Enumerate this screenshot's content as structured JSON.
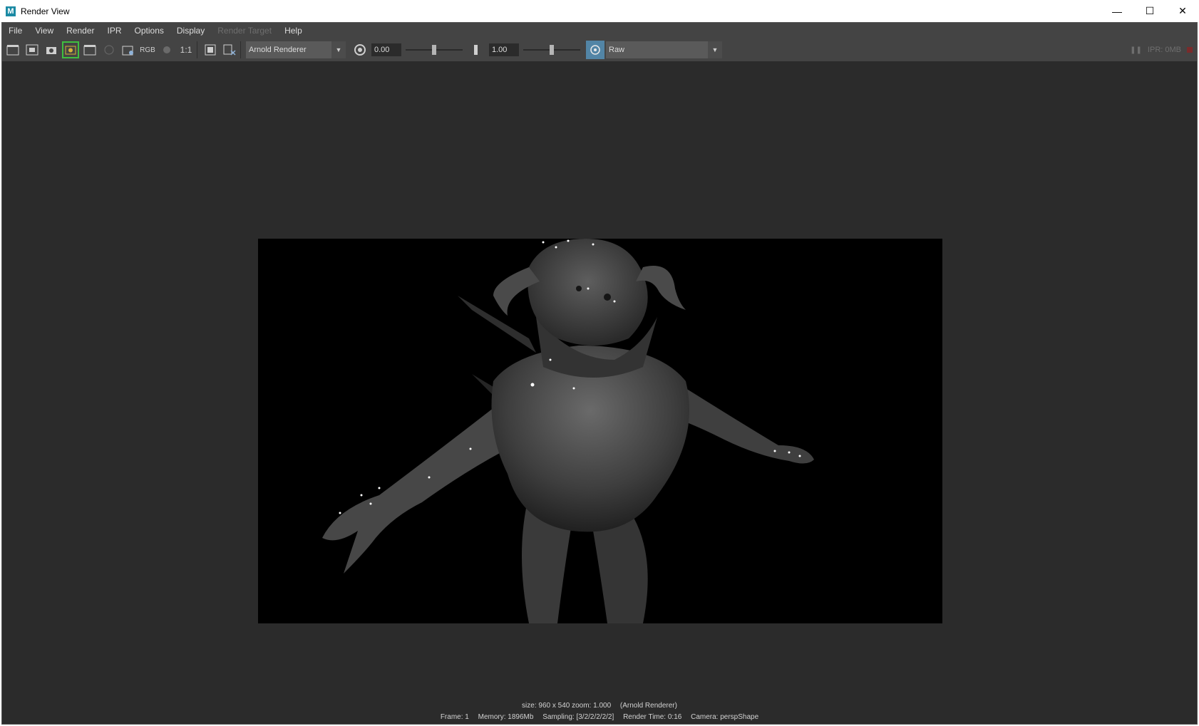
{
  "window": {
    "title": "Render View",
    "app_icon_letter": "M",
    "minimize": "—",
    "maximize": "☐",
    "close": "✕"
  },
  "menu": {
    "items": [
      "File",
      "View",
      "Render",
      "IPR",
      "Options",
      "Display",
      "Render Target",
      "Help"
    ]
  },
  "toolbar": {
    "ratio_label": "1:1",
    "rgb_label": "RGB",
    "renderer": "Arnold Renderer",
    "exposure_value": "0.00",
    "exposure_slider": 0.5,
    "gamma_value": "1.00",
    "gamma_slider": 0.5,
    "colorspace_view": "Raw",
    "ipr_memory": "IPR: 0MB",
    "accent_color": "#5285a6",
    "active_color": "#3fbf3f"
  },
  "status": {
    "size": "size: 960 x 540 zoom: 1.000",
    "renderer": "(Arnold Renderer)",
    "frame": "Frame: 1",
    "memory": "Memory: 1896Mb",
    "sampling": "Sampling: [3/2/2/2/2/2]",
    "render_time": "Render Time: 0:16",
    "camera": "Camera: perspShape"
  }
}
